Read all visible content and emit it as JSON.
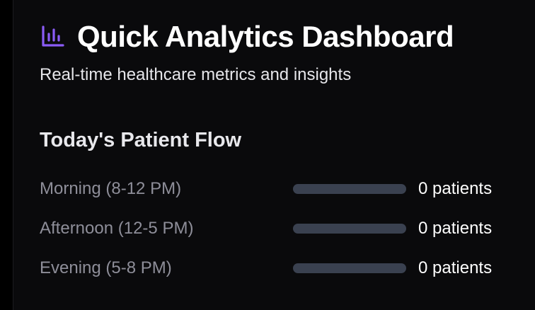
{
  "header": {
    "icon": "bar-chart-icon",
    "title": "Quick Analytics Dashboard",
    "subtitle": "Real-time healthcare metrics and insights"
  },
  "patient_flow": {
    "title": "Today's Patient Flow",
    "rows": [
      {
        "label": "Morning (8-12 PM)",
        "value": 0,
        "unit": "patients",
        "fill_fraction": 0
      },
      {
        "label": "Afternoon (12-5 PM)",
        "value": 0,
        "unit": "patients",
        "fill_fraction": 0
      },
      {
        "label": "Evening (5-8 PM)",
        "value": 0,
        "unit": "patients",
        "fill_fraction": 0
      }
    ]
  },
  "colors": {
    "accent": "#8b5cf6",
    "bar_track": "#3a4150",
    "background": "#0a0a0c"
  }
}
